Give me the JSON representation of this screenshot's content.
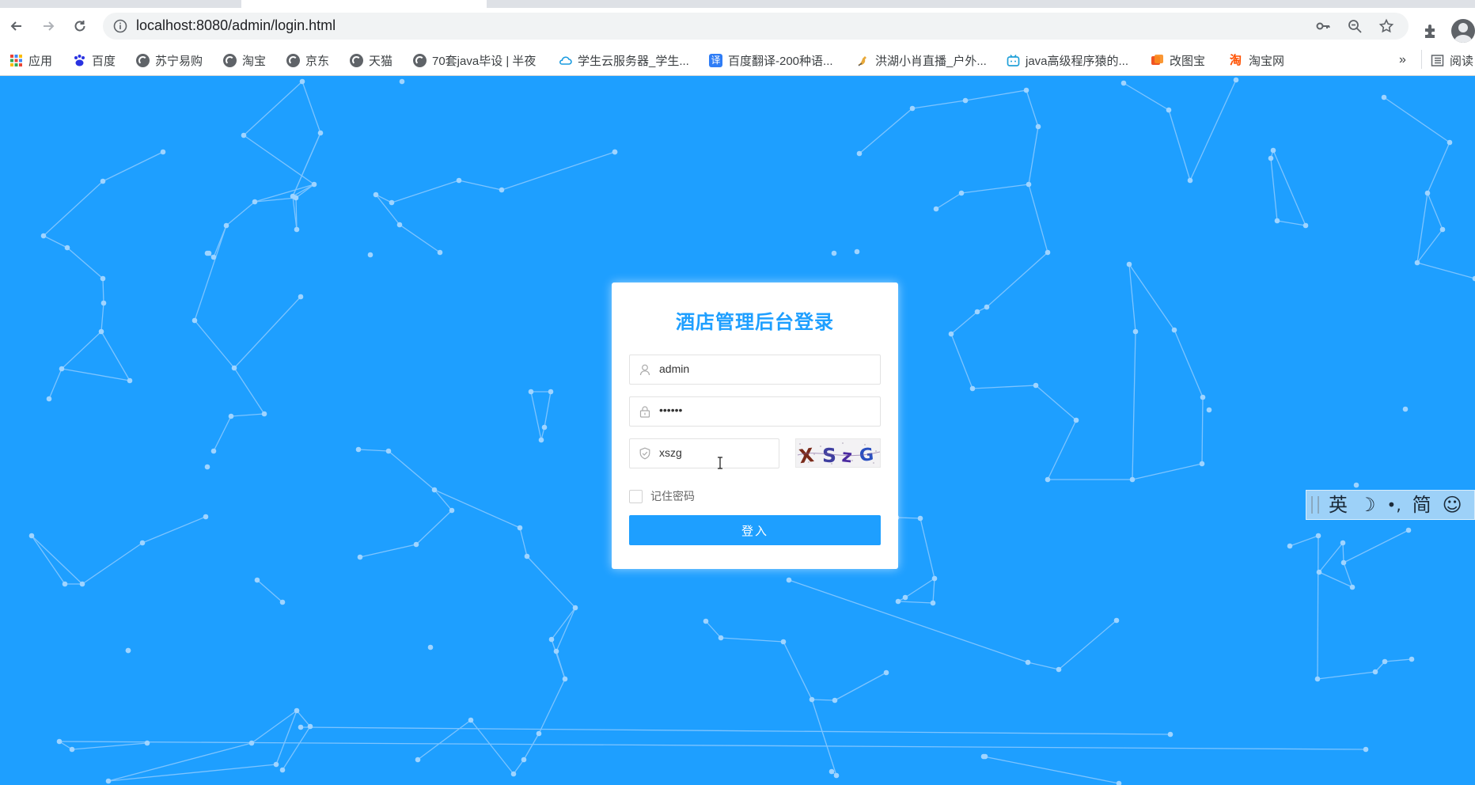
{
  "browser": {
    "url": "localhost:8080/admin/login.html",
    "bookmarks": [
      {
        "label": "应用",
        "icon": "apps-grid-icon"
      },
      {
        "label": "百度",
        "icon": "baidu-paw-icon"
      },
      {
        "label": "苏宁易购",
        "icon": "globe-icon"
      },
      {
        "label": "淘宝",
        "icon": "globe-icon"
      },
      {
        "label": "京东",
        "icon": "globe-icon"
      },
      {
        "label": "天猫",
        "icon": "globe-icon"
      },
      {
        "label": "70套java毕设 | 半夜",
        "icon": "globe-icon"
      },
      {
        "label": "学生云服务器_学生...",
        "icon": "cloud-icon"
      },
      {
        "label": "百度翻译-200种语...",
        "icon": "translate-icon"
      },
      {
        "label": "洪湖小肖直播_户外...",
        "icon": "bird-icon"
      },
      {
        "label": "java高级程序猿的...",
        "icon": "bilibili-icon"
      },
      {
        "label": "改图宝",
        "icon": "image-editor-icon"
      },
      {
        "label": "淘宝网",
        "icon": "taobao-icon"
      }
    ],
    "overflow_label": "»",
    "reading_list_label": "阅读"
  },
  "login": {
    "title": "酒店管理后台登录",
    "username_value": "admin",
    "password_value": "••••••",
    "captcha_value": "xszg",
    "captcha_image_text": "XSzG",
    "remember_label": "记住密码",
    "login_button_label": "登入"
  },
  "ime": {
    "lang": "英",
    "moon": "☽",
    "punct": "•,",
    "script": "简",
    "emoji": "☺"
  },
  "colors": {
    "background": "#1e9fff",
    "accent": "#1e9fff",
    "network_lines": "#8ecbff"
  }
}
